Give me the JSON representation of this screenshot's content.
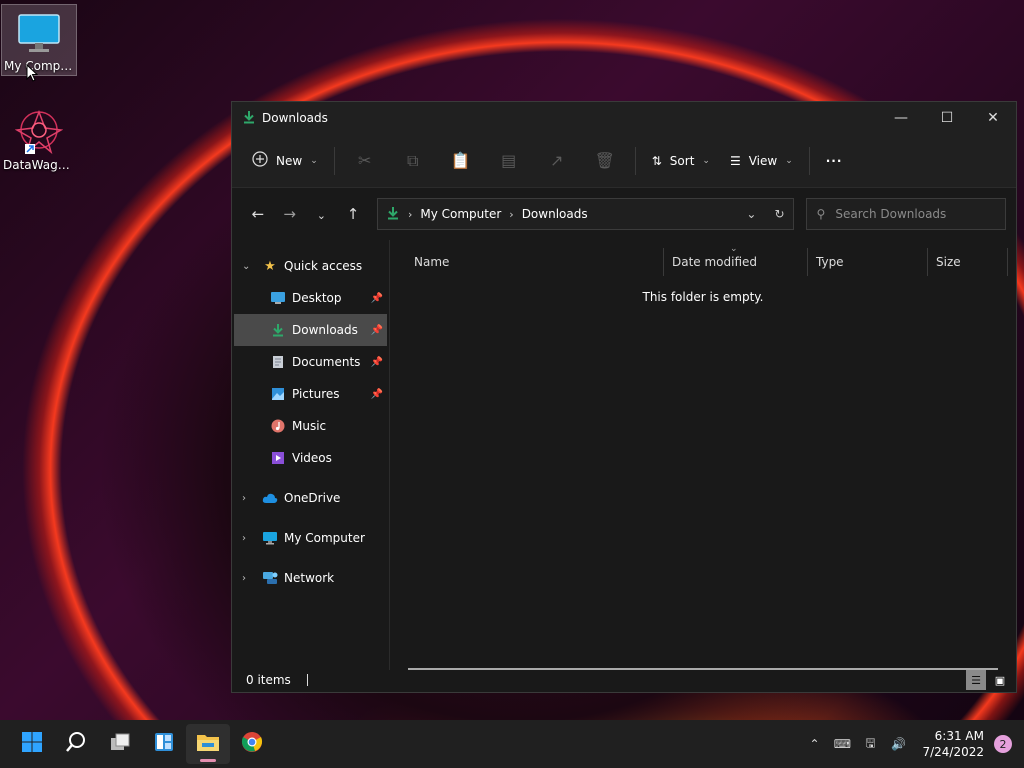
{
  "desktop": {
    "icons": [
      {
        "label": "My Computer",
        "icon": "monitor-icon"
      },
      {
        "label": "DataWagon...",
        "icon": "datawagon-app-icon"
      }
    ]
  },
  "window": {
    "title": "Downloads",
    "toolbar": {
      "new_label": "New",
      "sort_label": "Sort",
      "view_label": "View",
      "more_label": "···"
    },
    "address": {
      "crumbs": [
        "My Computer",
        "Downloads"
      ]
    },
    "search": {
      "placeholder": "Search Downloads"
    },
    "sidebar": {
      "quick_access": "Quick access",
      "items": [
        {
          "label": "Desktop",
          "pinned": true
        },
        {
          "label": "Downloads",
          "pinned": true,
          "active": true
        },
        {
          "label": "Documents",
          "pinned": true
        },
        {
          "label": "Pictures",
          "pinned": true
        },
        {
          "label": "Music",
          "pinned": false
        },
        {
          "label": "Videos",
          "pinned": false
        }
      ],
      "roots": [
        "OneDrive",
        "My Computer",
        "Network"
      ]
    },
    "columns": [
      "Name",
      "Date modified",
      "Type",
      "Size"
    ],
    "empty_message": "This folder is empty.",
    "status": "0 items"
  },
  "taskbar": {
    "time": "6:31 AM",
    "date": "7/24/2022",
    "notification_count": "2"
  },
  "colors": {
    "accent_green": "#2ea86a",
    "folder_yellow": "#f3c24a",
    "onedrive_blue": "#1e8fe1"
  }
}
